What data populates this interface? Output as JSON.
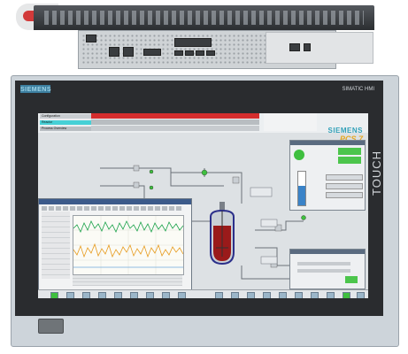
{
  "device": {
    "brand": "SIEMENS",
    "product_label": "SIMATIC HMI",
    "touch_label": "TOUCH"
  },
  "screen": {
    "nav": [
      {
        "label": "Configuration"
      },
      {
        "label": "Reactor"
      },
      {
        "label": "Process Overview"
      }
    ],
    "logo_top": "SIEMENS",
    "logo_bottom": "PCS 7"
  },
  "colors": {
    "alarm_red": "#d42d2d",
    "nav_active": "#46d0d6",
    "reactor_fill": "#9a1a1a",
    "trend_green": "#1aa24a",
    "trend_orange": "#e79b1e",
    "ok_green": "#3fbf3f"
  }
}
